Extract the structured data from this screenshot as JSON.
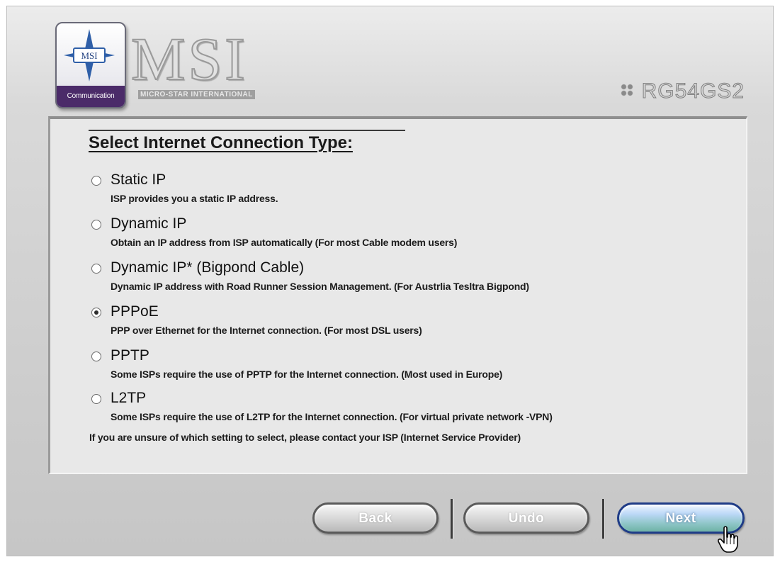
{
  "header": {
    "badge_top_text": "MSI",
    "badge_caption": "Communication",
    "brand_name": "MSI",
    "brand_subtitle": "MICRO-STAR INTERNATIONAL",
    "model": "RG54GS2"
  },
  "panel": {
    "title": "Select Internet Connection Type:",
    "options": [
      {
        "label": "Static IP",
        "description": "ISP provides you a static IP address.",
        "selected": false
      },
      {
        "label": "Dynamic IP",
        "description": "Obtain an IP address from ISP automatically (For most Cable modem users)",
        "selected": false
      },
      {
        "label": "Dynamic IP* (Bigpond Cable)",
        "description": "Dynamic IP address with Road Runner Session Management. (For Austrlia Tesltra Bigpond)",
        "selected": false
      },
      {
        "label": "PPPoE",
        "description": "PPP over Ethernet for the Internet connection. (For most DSL users)",
        "selected": true
      },
      {
        "label": "PPTP",
        "description": "Some ISPs require the use of PPTP for the Internet connection. (Most used in Europe)",
        "selected": false
      },
      {
        "label": "L2TP",
        "description": "Some ISPs require the use of L2TP for the Internet connection. (For virtual private network -VPN)",
        "selected": false
      }
    ],
    "footnote": "If you are unsure of which setting to select, please contact your ISP (Internet Service Provider)"
  },
  "buttons": {
    "back": "Back",
    "undo": "Undo",
    "next": "Next"
  },
  "icons": {
    "badge": "msi-compass-logo-icon",
    "cursor": "hand-pointer-icon",
    "model_marker": "dots-grid-icon"
  },
  "colors": {
    "badge_purple": "#4b2b69",
    "next_border": "#1f3c87",
    "panel_bg": "#e8e8e8"
  }
}
